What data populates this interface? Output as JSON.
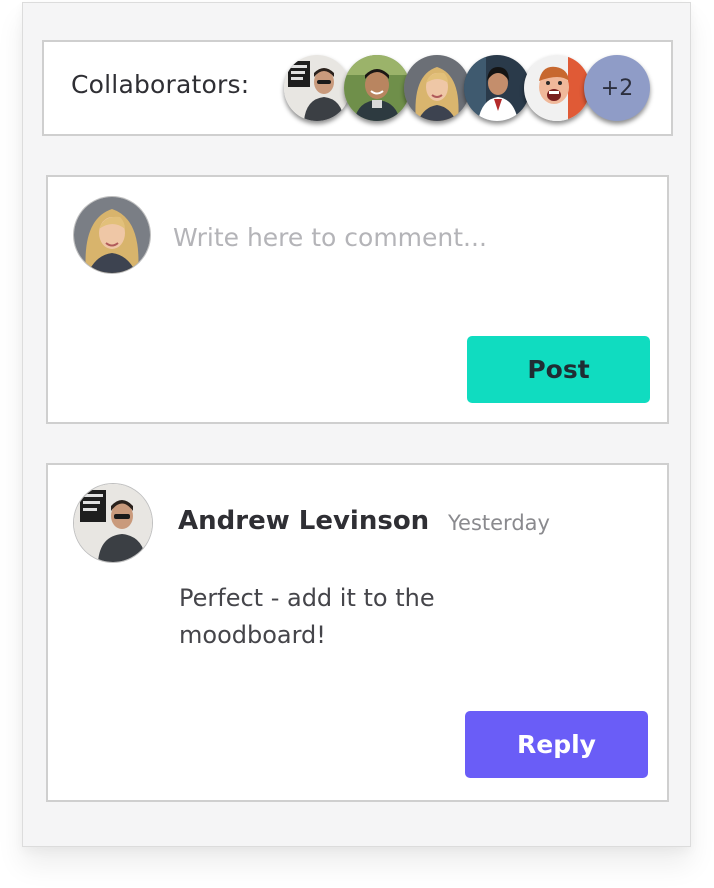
{
  "collaborators": {
    "label": "Collaborators:",
    "avatars": [
      {
        "name": "collaborator-avatar-1",
        "icon": "person-photo"
      },
      {
        "name": "collaborator-avatar-2",
        "icon": "person-photo"
      },
      {
        "name": "collaborator-avatar-3",
        "icon": "person-photo"
      },
      {
        "name": "collaborator-avatar-4",
        "icon": "person-photo"
      },
      {
        "name": "collaborator-avatar-5",
        "icon": "person-photo"
      }
    ],
    "overflow_count": "+2",
    "overflow_color": "#8f9cc7"
  },
  "compose": {
    "placeholder": "Write here to comment...",
    "value": "",
    "post_label": "Post",
    "post_color": "#10dcc0"
  },
  "comment": {
    "author": "Andrew Levinson",
    "timestamp": "Yesterday",
    "body": "Perfect - add it to the moodboard!",
    "reply_label": "Reply",
    "reply_color": "#6a5df7"
  }
}
